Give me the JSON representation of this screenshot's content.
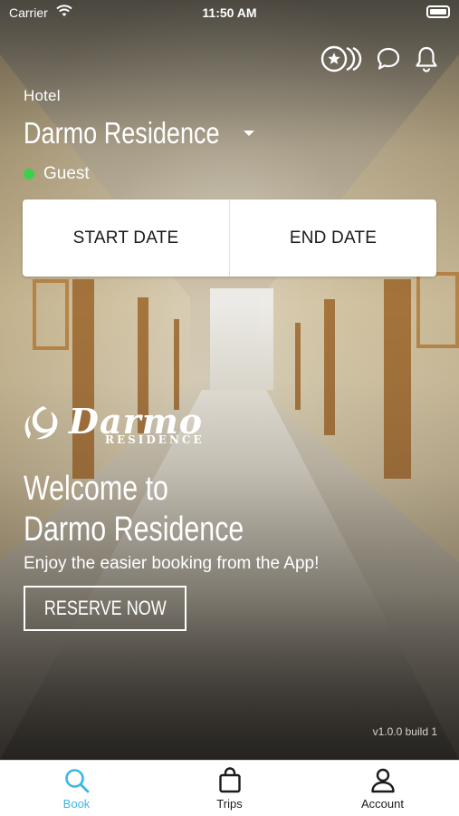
{
  "status_bar": {
    "carrier": "Carrier",
    "time": "11:50 AM"
  },
  "header": {
    "icons": [
      "loyalty-coins-icon",
      "chat-bubble-icon",
      "bell-icon"
    ],
    "property_type": "Hotel",
    "hotel_name": "Darmo Residence",
    "role": "Guest",
    "role_status_color": "#3bd14a"
  },
  "dates": {
    "start_label": "START DATE",
    "end_label": "END DATE"
  },
  "brand": {
    "logo_word": "Darmo",
    "logo_sub": "RESIDENCE"
  },
  "hero": {
    "welcome_line1": "Welcome to",
    "welcome_line2": "Darmo Residence",
    "tagline": "Enjoy the easier booking from the App!",
    "cta": "RESERVE NOW"
  },
  "version": "v1.0.0 build 1",
  "tabs": [
    {
      "label": "Book",
      "icon": "search-icon",
      "active": true
    },
    {
      "label": "Trips",
      "icon": "bag-icon",
      "active": false
    },
    {
      "label": "Account",
      "icon": "person-icon",
      "active": false
    }
  ],
  "colors": {
    "accent": "#3bb6e4",
    "text_dark": "#1a1a1a",
    "status_green": "#3bd14a"
  }
}
